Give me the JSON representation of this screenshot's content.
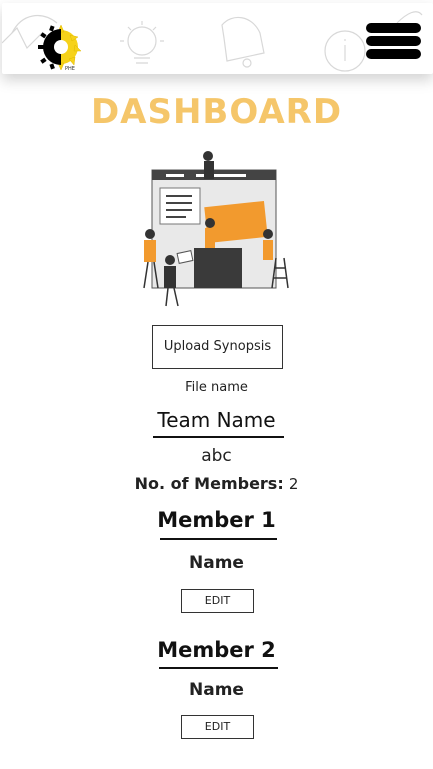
{
  "header": {
    "logo_icon": "sunflower-logo-icon",
    "logo_text": "PHE",
    "menu_icon": "hamburger-menu-icon"
  },
  "page": {
    "title": "DASHBOARD"
  },
  "upload": {
    "button_label": "Upload Synopsis",
    "file_name": "File name"
  },
  "team": {
    "heading": "Team Name",
    "value": "abc",
    "members_label": "No. of Members:",
    "members_value": "2"
  },
  "members": [
    {
      "heading": "Member 1",
      "name_label": "Name",
      "edit_label": "EDIT"
    },
    {
      "heading": "Member 2",
      "name_label": "Name",
      "edit_label": "EDIT"
    }
  ],
  "colors": {
    "title": "#f5c66a",
    "accent": "#f29a2e"
  }
}
